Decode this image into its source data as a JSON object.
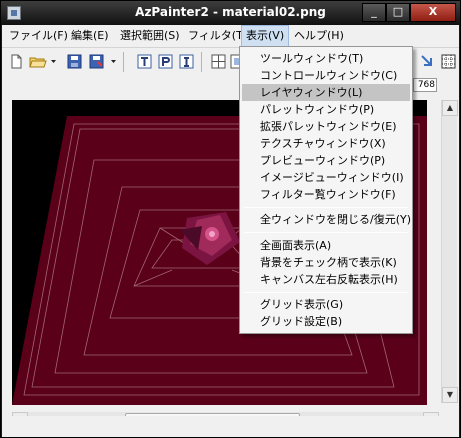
{
  "window": {
    "title": "AzPainter2 - material02.png",
    "minimize": "_",
    "maximize": "□",
    "close": "X"
  },
  "menubar": {
    "items": [
      {
        "label": "ファイル(F)"
      },
      {
        "label": "編集(E)"
      },
      {
        "label": "選択範囲(S)"
      },
      {
        "label": "フィルタ(T)"
      },
      {
        "label": "表示(V)"
      },
      {
        "label": "ヘルプ(H)"
      }
    ]
  },
  "toolbar": {
    "zoom_readout": "768"
  },
  "view_menu": {
    "items": [
      {
        "label": "ツールウィンドウ(T)"
      },
      {
        "label": "コントロールウィンドウ(C)"
      },
      {
        "label": "レイヤウィンドウ(L)"
      },
      {
        "label": "パレットウィンドウ(P)"
      },
      {
        "label": "拡張パレットウィンドウ(E)"
      },
      {
        "label": "テクスチャウィンドウ(X)"
      },
      {
        "label": "プレビューウィンドウ(P)"
      },
      {
        "label": "イメージビューウィンドウ(I)"
      },
      {
        "label": "フィルター覧ウィンドウ(F)"
      },
      {
        "label": "全ウィンドウを閉じる/復元(Y)"
      },
      {
        "label": "全画面表示(A)"
      },
      {
        "label": "背景をチェック柄で表示(K)"
      },
      {
        "label": "キャンバス左右反転表示(H)"
      },
      {
        "label": "グリッド表示(G)"
      },
      {
        "label": "グリッド設定(B)"
      }
    ]
  },
  "colors": {
    "canvas_bg": "#000000",
    "artwork": "#5b0019",
    "menu_highlight": "#c4c4c4"
  }
}
